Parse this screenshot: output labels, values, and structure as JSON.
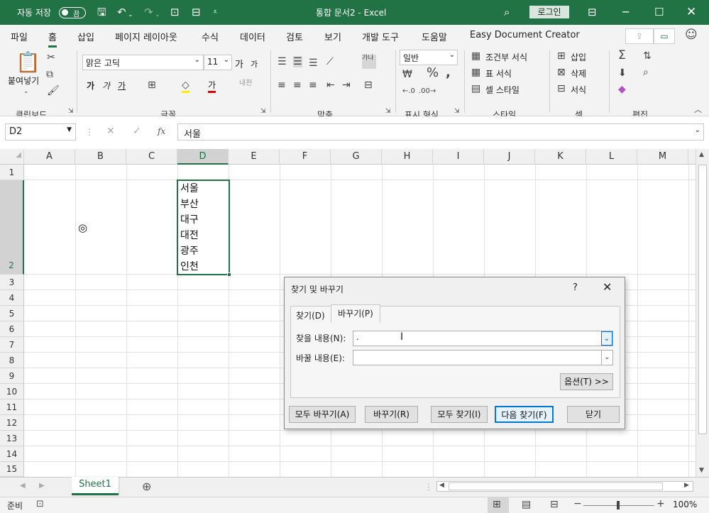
{
  "titlebar": {
    "autosave_label": "자동 저장",
    "autosave_state": "끔",
    "doc_title": "통합 문서2  -  Excel",
    "login": "로그인"
  },
  "tabs": [
    "파일",
    "홈",
    "삽입",
    "페이지 레이아웃",
    "수식",
    "데이터",
    "검토",
    "보기",
    "개발 도구",
    "도움말",
    "Easy Document Creator"
  ],
  "ribbon": {
    "clipboard": {
      "paste": "붙여넣기",
      "group": "클립보드"
    },
    "font": {
      "name": "맑은 고딕",
      "size": "11",
      "group": "글꼴",
      "bold": "가",
      "italic": "가",
      "underline": "가",
      "grow": "가",
      "shrink": "가",
      "color_char": "가"
    },
    "align": {
      "group": "맞춤"
    },
    "number": {
      "format": "일반",
      "group": "표시 형식"
    },
    "styles": {
      "cond": "조건부 서식",
      "table": "표 서식",
      "cell": "셀 스타일",
      "group": "스타일"
    },
    "cells": {
      "insert": "삽입",
      "delete": "삭제",
      "format": "서식",
      "group": "셀"
    },
    "edit": {
      "group": "편집"
    }
  },
  "formula_bar": {
    "name_box": "D2",
    "value": "서울",
    "fx": "fx"
  },
  "columns": [
    "A",
    "B",
    "C",
    "D",
    "E",
    "F",
    "G",
    "H",
    "I",
    "J",
    "K",
    "L",
    "M"
  ],
  "rows": [
    "1",
    "2",
    "3",
    "4",
    "5",
    "6",
    "7",
    "8",
    "9",
    "10",
    "11",
    "12",
    "13",
    "14",
    "15"
  ],
  "cells": {
    "D2": [
      "서울",
      "부산",
      "대구",
      "대전",
      "광주",
      "인천"
    ],
    "B2": "◎"
  },
  "sheet": {
    "tab": "Sheet1"
  },
  "status": {
    "ready": "준비",
    "zoom": "100%"
  },
  "dialog": {
    "title": "찾기 및 바꾸기",
    "help": "?",
    "tab_find": "찾기(D)",
    "tab_replace": "바꾸기(P)",
    "find_label": "찾을 내용(N):",
    "find_value": ".",
    "replace_label": "바꿀 내용(E):",
    "replace_value": "",
    "options": "옵션(T) >>",
    "replace_all": "모두 바꾸기(A)",
    "replace": "바꾸기(R)",
    "find_all": "모두 찾기(I)",
    "find_next": "다음 찾기(F)",
    "close": "닫기"
  }
}
